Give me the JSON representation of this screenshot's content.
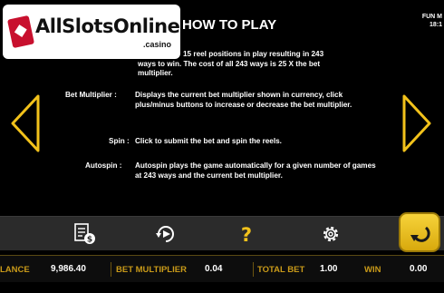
{
  "logo": {
    "text": "AllSlotsOnline",
    "sub": ".casino"
  },
  "title": "HOW TO PLAY",
  "corner": {
    "line1": "FUN M",
    "line2": "18:1"
  },
  "help": {
    "partial_line1": "15 reel positions in play resulting in 243",
    "partial_line2": "ways to win. The cost of all 243 ways is 25 X the bet",
    "partial_line3": "multiplier.",
    "items": [
      {
        "label": "Bet Multiplier :",
        "text": "Displays the current bet multiplier shown in currency, click plus/minus buttons to increase or decrease the bet multiplier."
      },
      {
        "label": "Spin :",
        "text": "Click to submit the bet and spin the reels."
      },
      {
        "label": "Autospin :",
        "text": "Autospin plays the game automatically for a given number of games at 243 ways and the current bet multiplier."
      }
    ]
  },
  "toolbar": {
    "icons": [
      "paytable-icon",
      "autospin-icon",
      "help-icon",
      "settings-icon",
      "back-arrow-icon"
    ],
    "help_glyph": "?"
  },
  "status": {
    "balance_label": "LANCE",
    "balance_value": "9,986.40",
    "bet_label": "BET MULTIPLIER",
    "bet_value": "0.04",
    "total_label": "TOTAL BET",
    "total_value": "1.00",
    "win_label": "WIN",
    "win_value": "0.00"
  },
  "colors": {
    "accent": "#f2c21b",
    "label": "#c99a19",
    "toolbar": "#2b2b2b"
  }
}
